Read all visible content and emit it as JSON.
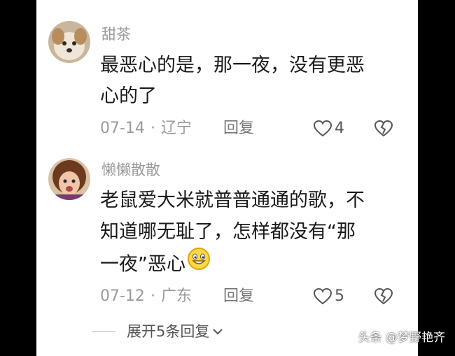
{
  "comments": [
    {
      "username": "甜茶",
      "lines": [
        "最恶心的是，那一夜，没有更恶",
        "心的了"
      ],
      "date": "07-14",
      "separator": "·",
      "location": "辽宁",
      "reply_label": "回复",
      "like_count": "4",
      "avatar_icon": "dog-avatar-icon"
    },
    {
      "username": "懒懒散散",
      "lines": [
        "老鼠爱大米就普普通通的歌，不",
        "知道哪无耻了，怎样都没有“那",
        "一夜”恶心"
      ],
      "date": "07-12",
      "separator": "·",
      "location": "广东",
      "reply_label": "回复",
      "like_count": "5",
      "avatar_icon": "child-avatar-icon",
      "trailing_emoji": "grinning-emoji-icon"
    }
  ],
  "expand_label": "展开5条回复",
  "watermark": "头条 @梦野艳齐",
  "colors": {
    "meta": "#9a9a9a",
    "text": "#1a1a1a",
    "background": "#ffffff",
    "frame": "#000000"
  }
}
